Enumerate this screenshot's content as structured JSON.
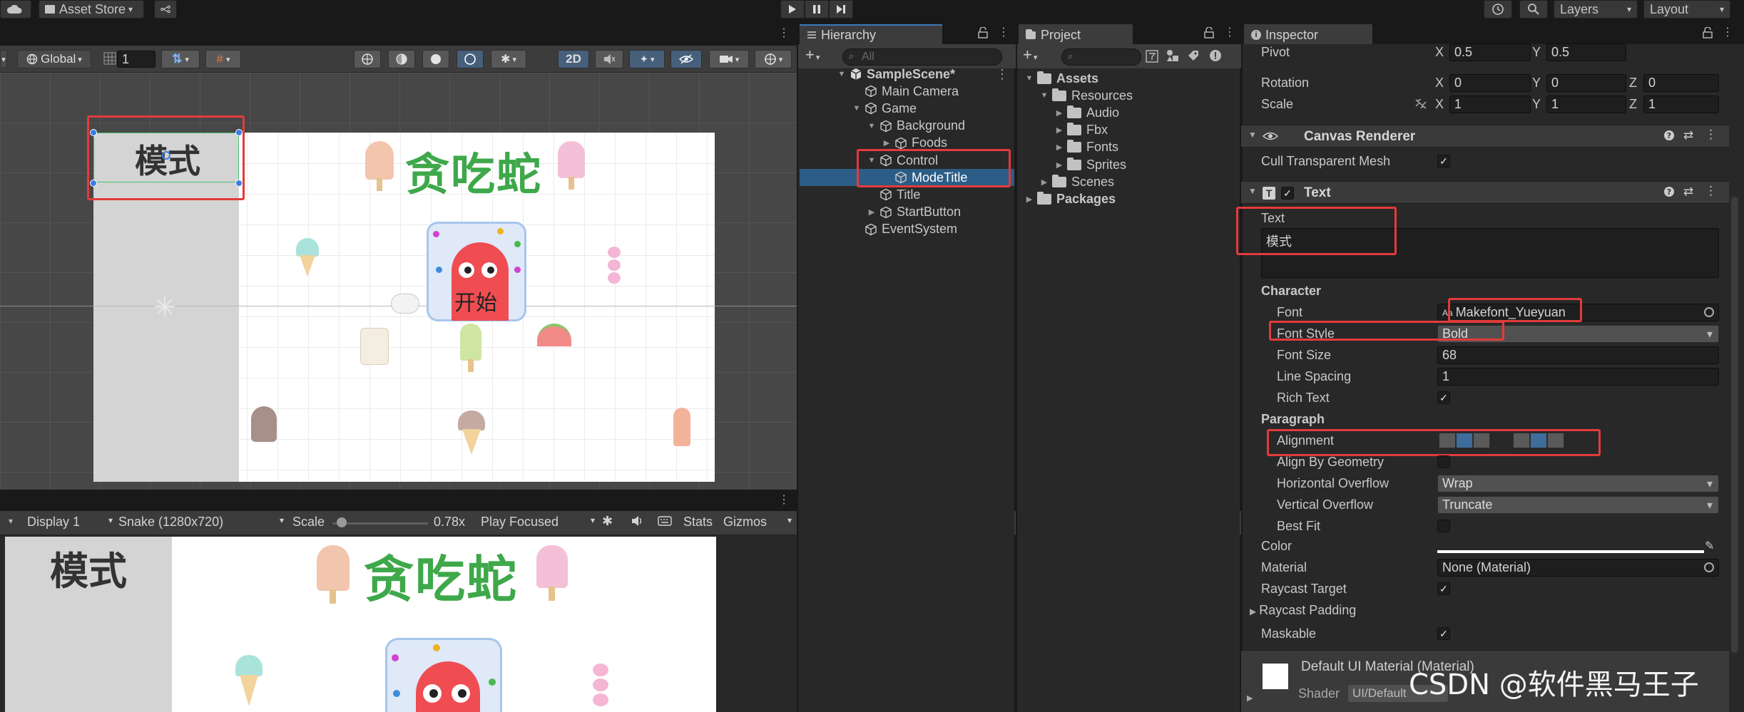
{
  "topbar": {
    "asset_store": "Asset Store",
    "layers": "Layers",
    "layout": "Layout"
  },
  "scene_toolbar": {
    "global": "Global",
    "grid_value": "1",
    "mode_2d": "2D"
  },
  "scene_view": {
    "mode_title": "模式",
    "game_title": "贪吃蛇",
    "start_text": "开始"
  },
  "game_toolbar": {
    "display": "Display 1",
    "resolution": "Snake (1280x720)",
    "scale_label": "Scale",
    "scale_value": "0.78x",
    "play_focused": "Play Focused",
    "stats": "Stats",
    "gizmos": "Gizmos",
    "scale_fraction": 0.05
  },
  "hierarchy": {
    "tab": "Hierarchy",
    "search_placeholder": "All",
    "items": [
      {
        "label": "SampleScene*"
      },
      {
        "label": "Main Camera"
      },
      {
        "label": "Game"
      },
      {
        "label": "Background"
      },
      {
        "label": "Foods"
      },
      {
        "label": "Control"
      },
      {
        "label": "ModeTitle"
      },
      {
        "label": "Title"
      },
      {
        "label": "StartButton"
      },
      {
        "label": "EventSystem"
      }
    ]
  },
  "project": {
    "tab": "Project",
    "items": [
      {
        "label": "Assets"
      },
      {
        "label": "Resources"
      },
      {
        "label": "Audio"
      },
      {
        "label": "Fbx"
      },
      {
        "label": "Fonts"
      },
      {
        "label": "Sprites"
      },
      {
        "label": "Scenes"
      },
      {
        "label": "Packages"
      }
    ]
  },
  "inspector": {
    "tab": "Inspector",
    "pivot_label": "Pivot",
    "pivot_x": "0.5",
    "pivot_y": "0.5",
    "rotation_label": "Rotation",
    "rotation_x": "0",
    "rotation_y": "0",
    "rotation_z": "0",
    "scale_label": "Scale",
    "scale_x": "1",
    "scale_y": "1",
    "scale_z": "1",
    "x": "X",
    "y": "Y",
    "z": "Z",
    "canvas_renderer": "Canvas Renderer",
    "cull_transparent": "Cull Transparent Mesh",
    "text_component": "Text",
    "text_label": "Text",
    "text_value": "模式",
    "character": "Character",
    "font_label": "Font",
    "font_value": "Makefont_Yueyuan",
    "font_style_label": "Font Style",
    "font_style_value": "Bold",
    "font_size_label": "Font Size",
    "font_size_value": "68",
    "line_spacing_label": "Line Spacing",
    "line_spacing_value": "1",
    "rich_text_label": "Rich Text",
    "paragraph": "Paragraph",
    "alignment_label": "Alignment",
    "align_geometry_label": "Align By Geometry",
    "h_overflow_label": "Horizontal Overflow",
    "h_overflow_value": "Wrap",
    "v_overflow_label": "Vertical Overflow",
    "v_overflow_value": "Truncate",
    "best_fit_label": "Best Fit",
    "color_label": "Color",
    "material_label": "Material",
    "material_value": "None (Material)",
    "raycast_target_label": "Raycast Target",
    "raycast_padding_label": "Raycast Padding",
    "maskable_label": "Maskable",
    "default_material": "Default UI Material (Material)",
    "shader_label": "Shader",
    "shader_value": "UI/Default"
  },
  "watermark": "CSDN @软件黑马王子",
  "colors": {
    "selection": "#2c5d87",
    "highlight_box": "#e23b3b",
    "title_green": "#3ea84a"
  }
}
